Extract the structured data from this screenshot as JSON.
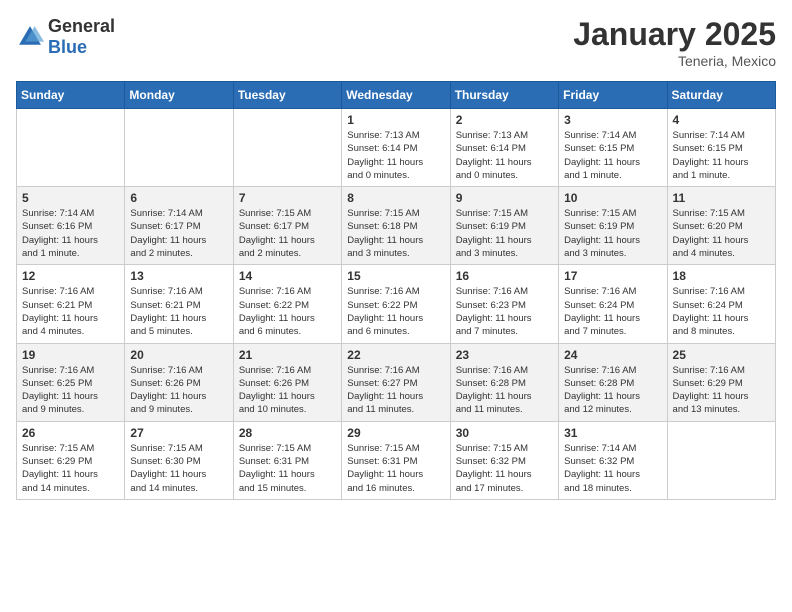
{
  "logo": {
    "general": "General",
    "blue": "Blue"
  },
  "title": "January 2025",
  "location": "Teneria, Mexico",
  "weekdays": [
    "Sunday",
    "Monday",
    "Tuesday",
    "Wednesday",
    "Thursday",
    "Friday",
    "Saturday"
  ],
  "weeks": [
    [
      {
        "day": "",
        "info": ""
      },
      {
        "day": "",
        "info": ""
      },
      {
        "day": "",
        "info": ""
      },
      {
        "day": "1",
        "info": "Sunrise: 7:13 AM\nSunset: 6:14 PM\nDaylight: 11 hours\nand 0 minutes."
      },
      {
        "day": "2",
        "info": "Sunrise: 7:13 AM\nSunset: 6:14 PM\nDaylight: 11 hours\nand 0 minutes."
      },
      {
        "day": "3",
        "info": "Sunrise: 7:14 AM\nSunset: 6:15 PM\nDaylight: 11 hours\nand 1 minute."
      },
      {
        "day": "4",
        "info": "Sunrise: 7:14 AM\nSunset: 6:15 PM\nDaylight: 11 hours\nand 1 minute."
      }
    ],
    [
      {
        "day": "5",
        "info": "Sunrise: 7:14 AM\nSunset: 6:16 PM\nDaylight: 11 hours\nand 1 minute."
      },
      {
        "day": "6",
        "info": "Sunrise: 7:14 AM\nSunset: 6:17 PM\nDaylight: 11 hours\nand 2 minutes."
      },
      {
        "day": "7",
        "info": "Sunrise: 7:15 AM\nSunset: 6:17 PM\nDaylight: 11 hours\nand 2 minutes."
      },
      {
        "day": "8",
        "info": "Sunrise: 7:15 AM\nSunset: 6:18 PM\nDaylight: 11 hours\nand 3 minutes."
      },
      {
        "day": "9",
        "info": "Sunrise: 7:15 AM\nSunset: 6:19 PM\nDaylight: 11 hours\nand 3 minutes."
      },
      {
        "day": "10",
        "info": "Sunrise: 7:15 AM\nSunset: 6:19 PM\nDaylight: 11 hours\nand 3 minutes."
      },
      {
        "day": "11",
        "info": "Sunrise: 7:15 AM\nSunset: 6:20 PM\nDaylight: 11 hours\nand 4 minutes."
      }
    ],
    [
      {
        "day": "12",
        "info": "Sunrise: 7:16 AM\nSunset: 6:21 PM\nDaylight: 11 hours\nand 4 minutes."
      },
      {
        "day": "13",
        "info": "Sunrise: 7:16 AM\nSunset: 6:21 PM\nDaylight: 11 hours\nand 5 minutes."
      },
      {
        "day": "14",
        "info": "Sunrise: 7:16 AM\nSunset: 6:22 PM\nDaylight: 11 hours\nand 6 minutes."
      },
      {
        "day": "15",
        "info": "Sunrise: 7:16 AM\nSunset: 6:22 PM\nDaylight: 11 hours\nand 6 minutes."
      },
      {
        "day": "16",
        "info": "Sunrise: 7:16 AM\nSunset: 6:23 PM\nDaylight: 11 hours\nand 7 minutes."
      },
      {
        "day": "17",
        "info": "Sunrise: 7:16 AM\nSunset: 6:24 PM\nDaylight: 11 hours\nand 7 minutes."
      },
      {
        "day": "18",
        "info": "Sunrise: 7:16 AM\nSunset: 6:24 PM\nDaylight: 11 hours\nand 8 minutes."
      }
    ],
    [
      {
        "day": "19",
        "info": "Sunrise: 7:16 AM\nSunset: 6:25 PM\nDaylight: 11 hours\nand 9 minutes."
      },
      {
        "day": "20",
        "info": "Sunrise: 7:16 AM\nSunset: 6:26 PM\nDaylight: 11 hours\nand 9 minutes."
      },
      {
        "day": "21",
        "info": "Sunrise: 7:16 AM\nSunset: 6:26 PM\nDaylight: 11 hours\nand 10 minutes."
      },
      {
        "day": "22",
        "info": "Sunrise: 7:16 AM\nSunset: 6:27 PM\nDaylight: 11 hours\nand 11 minutes."
      },
      {
        "day": "23",
        "info": "Sunrise: 7:16 AM\nSunset: 6:28 PM\nDaylight: 11 hours\nand 11 minutes."
      },
      {
        "day": "24",
        "info": "Sunrise: 7:16 AM\nSunset: 6:28 PM\nDaylight: 11 hours\nand 12 minutes."
      },
      {
        "day": "25",
        "info": "Sunrise: 7:16 AM\nSunset: 6:29 PM\nDaylight: 11 hours\nand 13 minutes."
      }
    ],
    [
      {
        "day": "26",
        "info": "Sunrise: 7:15 AM\nSunset: 6:29 PM\nDaylight: 11 hours\nand 14 minutes."
      },
      {
        "day": "27",
        "info": "Sunrise: 7:15 AM\nSunset: 6:30 PM\nDaylight: 11 hours\nand 14 minutes."
      },
      {
        "day": "28",
        "info": "Sunrise: 7:15 AM\nSunset: 6:31 PM\nDaylight: 11 hours\nand 15 minutes."
      },
      {
        "day": "29",
        "info": "Sunrise: 7:15 AM\nSunset: 6:31 PM\nDaylight: 11 hours\nand 16 minutes."
      },
      {
        "day": "30",
        "info": "Sunrise: 7:15 AM\nSunset: 6:32 PM\nDaylight: 11 hours\nand 17 minutes."
      },
      {
        "day": "31",
        "info": "Sunrise: 7:14 AM\nSunset: 6:32 PM\nDaylight: 11 hours\nand 18 minutes."
      },
      {
        "day": "",
        "info": ""
      }
    ]
  ]
}
